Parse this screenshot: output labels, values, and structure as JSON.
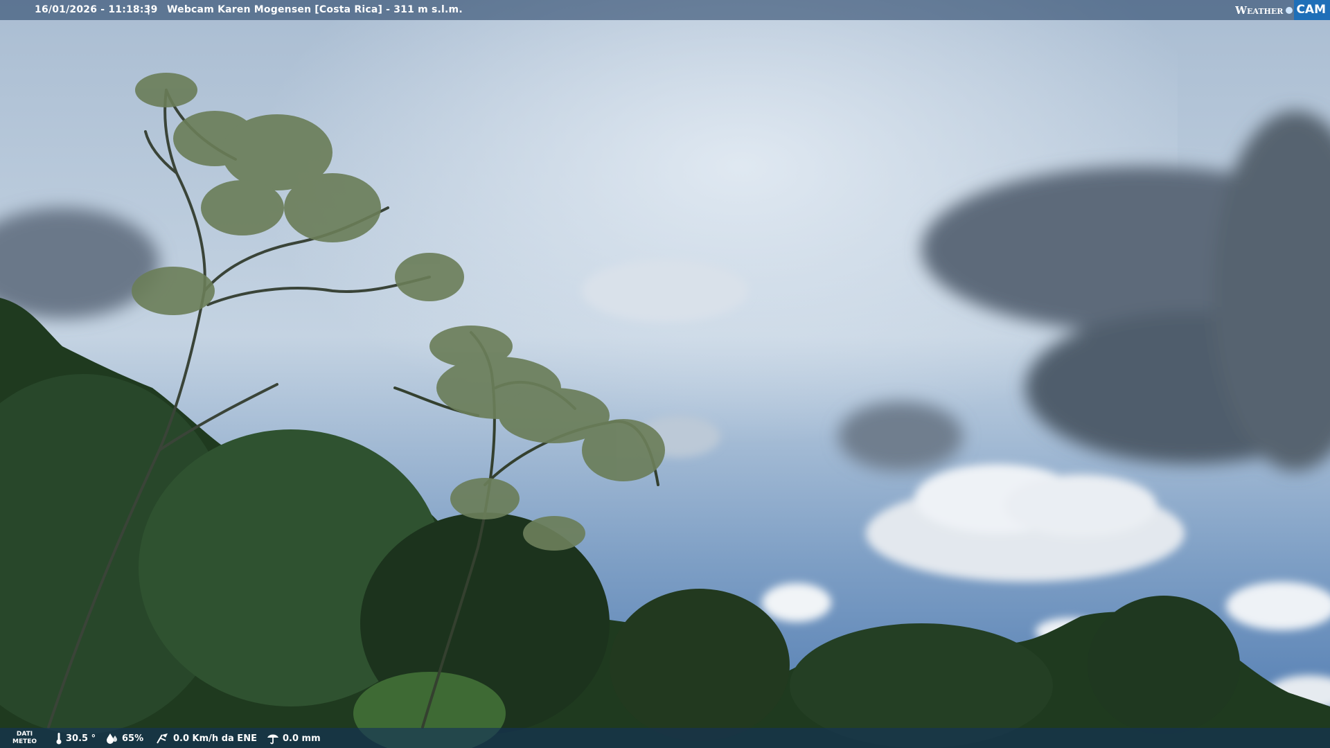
{
  "header": {
    "timestamp": "16/01/2026 - 11:18:39",
    "separator": "|",
    "title": "Webcam Karen Mogensen [Costa Rica] - 311 m s.l.m.",
    "logo_left": "Weather",
    "logo_right": "CAM"
  },
  "footer": {
    "label_line1": "DATI",
    "label_line2": "METEO",
    "temperature": "30.5 °",
    "humidity": "65%",
    "wind": "0.0 Km/h da ENE",
    "rain": "0.0 mm",
    "icons": [
      "thermometer-icon",
      "humidity-drop-icon",
      "wind-icon",
      "rain-icon"
    ]
  },
  "colors": {
    "bar": "#1e3a5f",
    "logo_accent": "#1f6fb8"
  }
}
